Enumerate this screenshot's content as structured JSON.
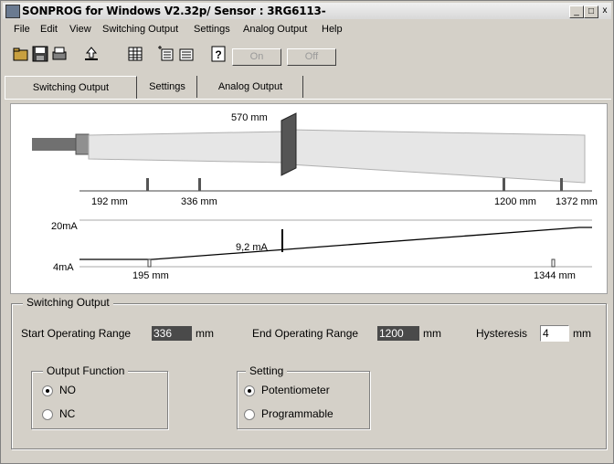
{
  "window": {
    "title": "SONPROG for Windows V2.32p/ Sensor : 3RG6113-",
    "controls": {
      "minimize": "_",
      "maximize": "□",
      "close": "x"
    }
  },
  "menu": [
    "File",
    "Edit",
    "View",
    "Switching Output",
    "Settings",
    "Analog Output",
    "Help"
  ],
  "toolbar": {
    "icons": [
      "open-icon",
      "save-icon",
      "print-icon",
      "upload-icon",
      "table-icon",
      "import-icon",
      "export-icon",
      "help-icon"
    ],
    "on_label": "On",
    "off_label": "Off"
  },
  "tabs": [
    "Switching Output",
    "Settings",
    "Analog Output"
  ],
  "graph": {
    "target_label": "570 mm",
    "markers": {
      "m1": "192 mm",
      "m2": "336 mm",
      "m3": "1200 mm",
      "m4": "1372 mm"
    },
    "analog": {
      "high": "20mA",
      "low": "4mA",
      "current": "9,2 mA",
      "start": "195 mm",
      "end": "1344 mm"
    }
  },
  "switching": {
    "group_title": "Switching Output",
    "start_label": "Start Operating Range",
    "start_value": "336",
    "end_label": "End Operating Range",
    "end_value": "1200",
    "unit": "mm",
    "hyst_label": "Hysteresis",
    "hyst_value": "4"
  },
  "output_function": {
    "title": "Output Function",
    "options": [
      "NO",
      "NC"
    ],
    "selected": "NO"
  },
  "setting": {
    "title": "Setting",
    "options": [
      "Potentiometer",
      "Programmable"
    ],
    "selected": "Potentiometer"
  }
}
